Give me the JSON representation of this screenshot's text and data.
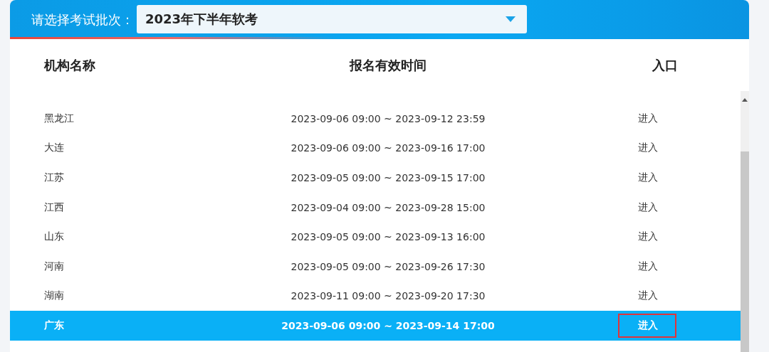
{
  "batch_select": {
    "label": "请选择考试批次：",
    "value": "2023年下半年软考"
  },
  "table": {
    "columns": [
      "机构名称",
      "报名有效时间",
      "入口"
    ],
    "rows": [
      {
        "name": "黑龙江",
        "period": "2023-09-06 09:00 ~ 2023-09-12 23:59",
        "entry": "进入",
        "selected": false,
        "outlined": false
      },
      {
        "name": "大连",
        "period": "2023-09-06 09:00 ~ 2023-09-16 17:00",
        "entry": "进入",
        "selected": false,
        "outlined": false
      },
      {
        "name": "江苏",
        "period": "2023-09-05 09:00 ~ 2023-09-15 17:00",
        "entry": "进入",
        "selected": false,
        "outlined": false
      },
      {
        "name": "江西",
        "period": "2023-09-04 09:00 ~ 2023-09-28 15:00",
        "entry": "进入",
        "selected": false,
        "outlined": false
      },
      {
        "name": "山东",
        "period": "2023-09-05 09:00 ~ 2023-09-13 16:00",
        "entry": "进入",
        "selected": false,
        "outlined": false
      },
      {
        "name": "河南",
        "period": "2023-09-05 09:00 ~ 2023-09-26 17:30",
        "entry": "进入",
        "selected": false,
        "outlined": false
      },
      {
        "name": "湖南",
        "period": "2023-09-11 09:00 ~ 2023-09-20 17:30",
        "entry": "进入",
        "selected": false,
        "outlined": false
      },
      {
        "name": "广东",
        "period": "2023-09-06 09:00 ~ 2023-09-14 17:00",
        "entry": "进入",
        "selected": true,
        "outlined": true
      }
    ]
  }
}
